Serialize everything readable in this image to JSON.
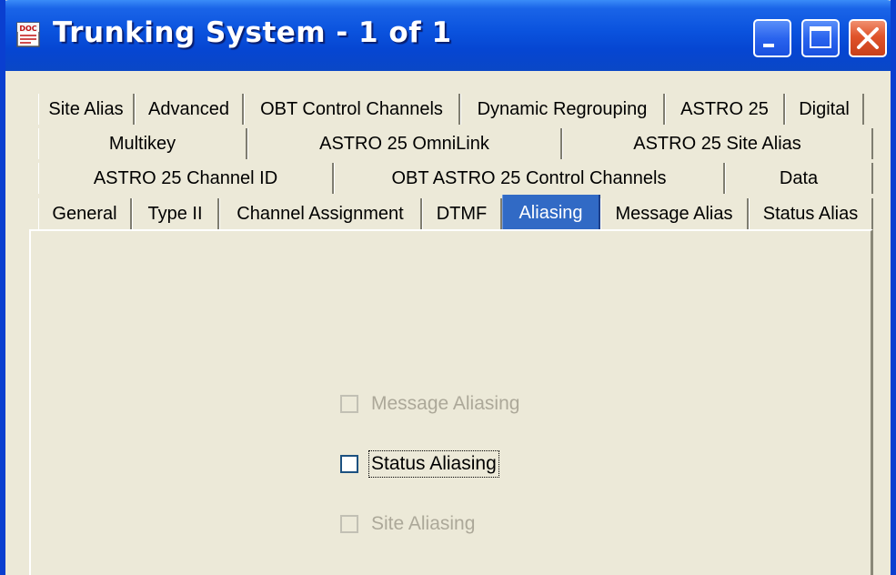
{
  "window": {
    "title": "Trunking System - 1 of 1",
    "icon": "doc-icon",
    "controls": [
      "minimize-icon",
      "maximize-icon",
      "close-icon"
    ]
  },
  "tabs": {
    "row1": [
      "Site Alias",
      "Advanced",
      "OBT Control Channels",
      "Dynamic Regrouping",
      "ASTRO 25",
      "Digital"
    ],
    "row2": [
      "Multikey",
      "ASTRO 25 OmniLink",
      "ASTRO 25 Site Alias"
    ],
    "row3": [
      "ASTRO 25 Channel ID",
      "OBT ASTRO 25 Control Channels",
      "Data"
    ],
    "row4": [
      "General",
      "Type II",
      "Channel Assignment",
      "DTMF",
      "Aliasing",
      "Message Alias",
      "Status Alias"
    ],
    "active": "Aliasing"
  },
  "options": {
    "message_aliasing": {
      "label": "Message Aliasing",
      "checked": false,
      "enabled": false
    },
    "status_aliasing": {
      "label": "Status Aliasing",
      "checked": false,
      "enabled": true
    },
    "site_aliasing": {
      "label": "Site Aliasing",
      "checked": false,
      "enabled": false
    }
  },
  "colors": {
    "titlebar": "#0a52dd",
    "active_tab": "#316ac5",
    "dialog_bg": "#ece9d8"
  }
}
